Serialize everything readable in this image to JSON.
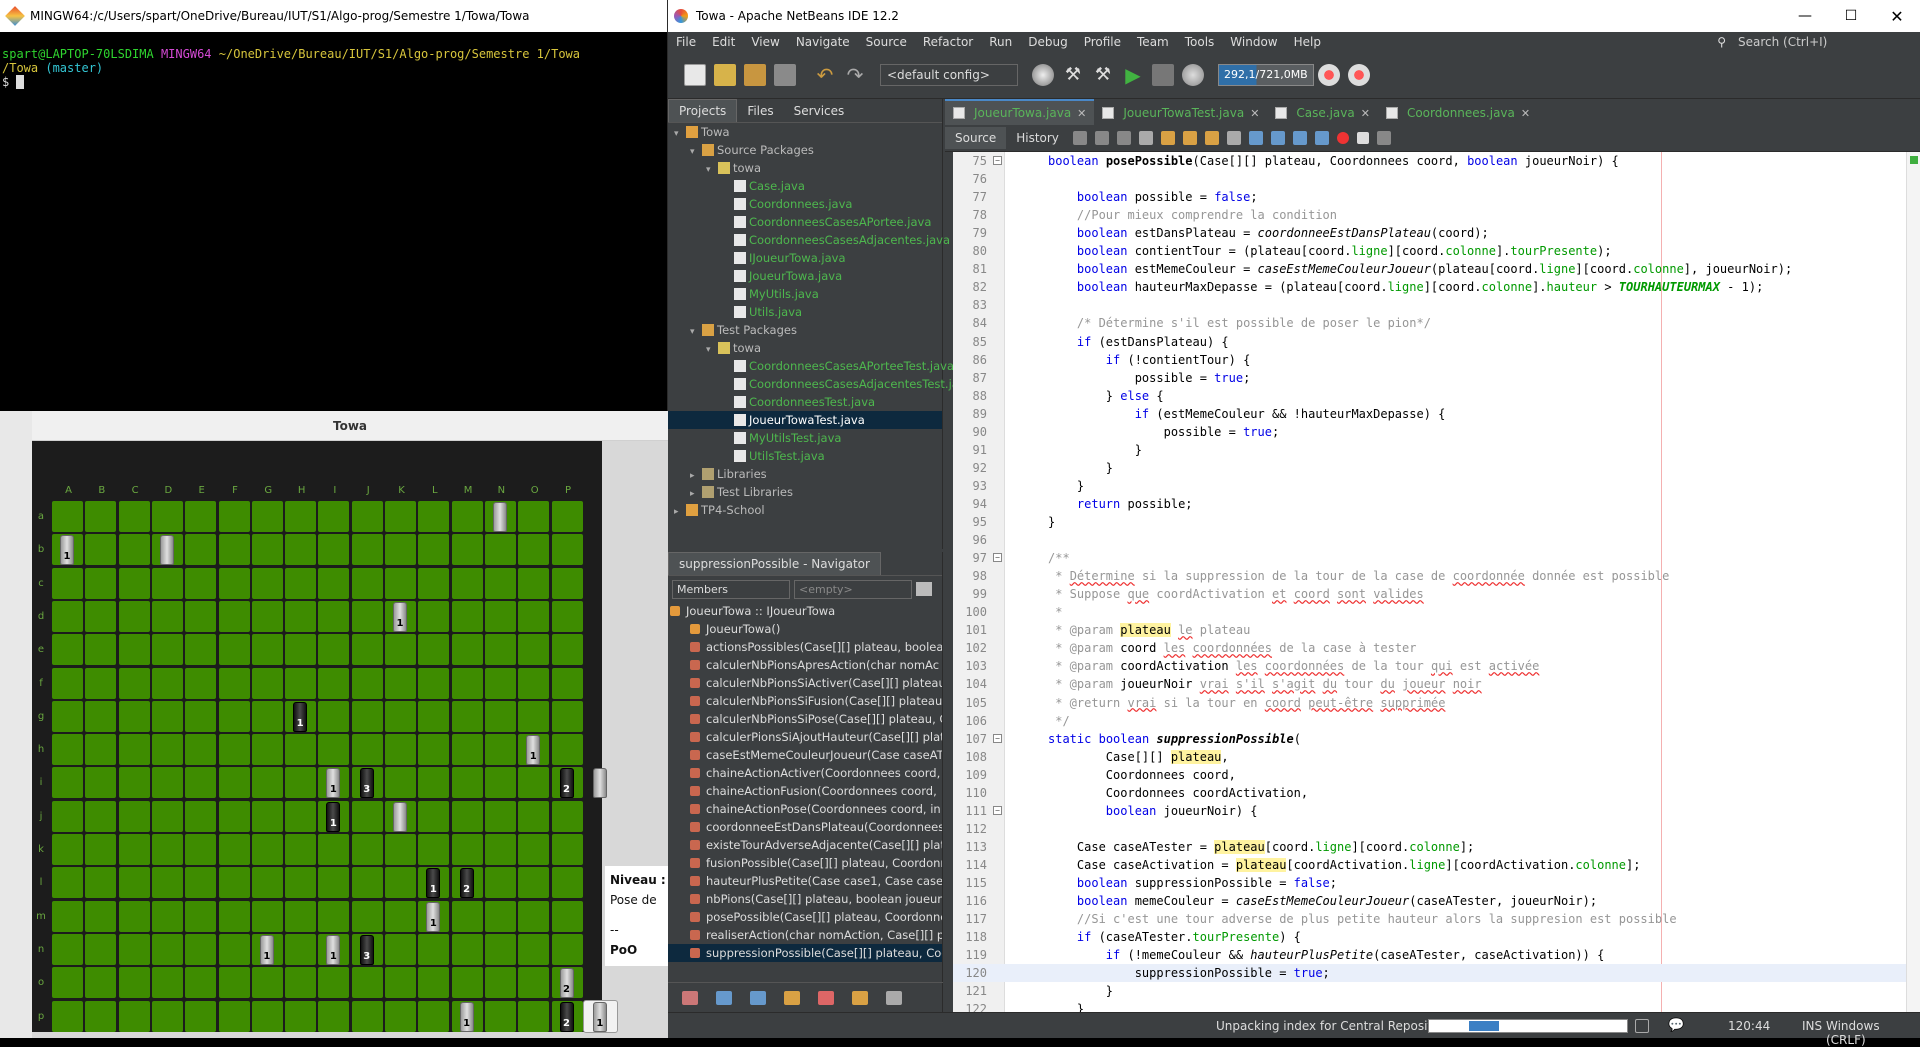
{
  "terminal": {
    "title": "MINGW64:/c/Users/spart/OneDrive/Bureau/IUT/S1/Algo-prog/Semestre 1/Towa/Towa",
    "prompt_user": "spart@LAPTOP-70LSDIMA",
    "prompt_env": "MINGW64",
    "prompt_path": "~/OneDrive/Bureau/IUT/S1/Algo-prog/Semestre 1/Towa",
    "prompt_path2": "/Towa",
    "prompt_branch": "(master)",
    "prompt_char": "$"
  },
  "game": {
    "title": "Towa",
    "columns": [
      "A",
      "B",
      "C",
      "D",
      "E",
      "F",
      "G",
      "H",
      "I",
      "J",
      "K",
      "L",
      "M",
      "N",
      "O",
      "P"
    ],
    "rows": [
      "a",
      "b",
      "c",
      "d",
      "e",
      "f",
      "g",
      "h",
      "i",
      "j",
      "k",
      "l",
      "m",
      "n",
      "o",
      "p"
    ],
    "pieces": [
      {
        "row": 0,
        "col": 13,
        "color": "w",
        "label": ""
      },
      {
        "row": 1,
        "col": 0,
        "color": "w",
        "label": "1"
      },
      {
        "row": 1,
        "col": 3,
        "color": "w",
        "label": ""
      },
      {
        "row": 3,
        "col": 10,
        "color": "w",
        "label": "1"
      },
      {
        "row": 6,
        "col": 7,
        "color": "b",
        "label": "1"
      },
      {
        "row": 7,
        "col": 14,
        "color": "w",
        "label": "1"
      },
      {
        "row": 8,
        "col": 8,
        "color": "w",
        "label": "1"
      },
      {
        "row": 8,
        "col": 9,
        "color": "b",
        "label": "3"
      },
      {
        "row": 8,
        "col": 15,
        "color": "b",
        "label": "2"
      },
      {
        "row": 8,
        "col": 16,
        "color": "w",
        "label": ""
      },
      {
        "row": 9,
        "col": 8,
        "color": "b",
        "label": "1"
      },
      {
        "row": 9,
        "col": 10,
        "color": "w",
        "label": ""
      },
      {
        "row": 11,
        "col": 11,
        "color": "b",
        "label": "1"
      },
      {
        "row": 11,
        "col": 12,
        "color": "b",
        "label": "2"
      },
      {
        "row": 12,
        "col": 11,
        "color": "w",
        "label": "1"
      },
      {
        "row": 13,
        "col": 6,
        "color": "w",
        "label": "1"
      },
      {
        "row": 13,
        "col": 8,
        "color": "w",
        "label": "1"
      },
      {
        "row": 13,
        "col": 9,
        "color": "b",
        "label": "3"
      },
      {
        "row": 14,
        "col": 15,
        "color": "w",
        "label": "2"
      },
      {
        "row": 15,
        "col": 12,
        "color": "w",
        "label": "1"
      },
      {
        "row": 15,
        "col": 15,
        "color": "b",
        "label": "2"
      },
      {
        "row": 15,
        "col": 16,
        "color": "w",
        "label": "1"
      }
    ],
    "info": {
      "line1": "Niveau :",
      "line2": "Pose de",
      "line3": "--",
      "line4": "PoO"
    }
  },
  "netbeans": {
    "title": "Towa - Apache NetBeans IDE 12.2",
    "menu": [
      "File",
      "Edit",
      "View",
      "Navigate",
      "Source",
      "Refactor",
      "Run",
      "Debug",
      "Profile",
      "Team",
      "Tools",
      "Window",
      "Help"
    ],
    "search_placeholder": "Search (Ctrl+I)",
    "config": "<default config>",
    "memory": "292,1/721,0MB",
    "panel_tabs": [
      "Projects",
      "Files",
      "Services"
    ],
    "tree": [
      {
        "depth": 0,
        "label": "Towa",
        "kind": "project"
      },
      {
        "depth": 1,
        "label": "Source Packages",
        "kind": "pkgroot"
      },
      {
        "depth": 2,
        "label": "towa",
        "kind": "pkg"
      },
      {
        "depth": 3,
        "label": "Case.java",
        "kind": "java"
      },
      {
        "depth": 3,
        "label": "Coordonnees.java",
        "kind": "java"
      },
      {
        "depth": 3,
        "label": "CoordonneesCasesAPortee.java",
        "kind": "java"
      },
      {
        "depth": 3,
        "label": "CoordonneesCasesAdjacentes.java",
        "kind": "java"
      },
      {
        "depth": 3,
        "label": "IJoueurTowa.java",
        "kind": "java"
      },
      {
        "depth": 3,
        "label": "JoueurTowa.java",
        "kind": "java"
      },
      {
        "depth": 3,
        "label": "MyUtils.java",
        "kind": "java"
      },
      {
        "depth": 3,
        "label": "Utils.java",
        "kind": "java"
      },
      {
        "depth": 1,
        "label": "Test Packages",
        "kind": "pkgroot"
      },
      {
        "depth": 2,
        "label": "towa",
        "kind": "pkg"
      },
      {
        "depth": 3,
        "label": "CoordonneesCasesAPorteeTest.java",
        "kind": "java"
      },
      {
        "depth": 3,
        "label": "CoordonneesCasesAdjacentesTest.java",
        "kind": "java"
      },
      {
        "depth": 3,
        "label": "CoordonneesTest.java",
        "kind": "java"
      },
      {
        "depth": 3,
        "label": "JoueurTowaTest.java",
        "kind": "java-sel"
      },
      {
        "depth": 3,
        "label": "MyUtilsTest.java",
        "kind": "java"
      },
      {
        "depth": 3,
        "label": "UtilsTest.java",
        "kind": "java"
      },
      {
        "depth": 1,
        "label": "Libraries",
        "kind": "lib"
      },
      {
        "depth": 1,
        "label": "Test Libraries",
        "kind": "lib"
      },
      {
        "depth": 0,
        "label": "TP4-School",
        "kind": "project"
      }
    ],
    "navigator": {
      "title": "suppressionPossible - Navigator",
      "filter": "Members",
      "filter2": "<empty>",
      "class": "JoueurTowa :: IJoueurTowa",
      "members": [
        "JoueurTowa()",
        "actionsPossibles(Case[][] plateau, boolean",
        "calculerNbPionsApresAction(char nomAc",
        "calculerNbPionsSiActiver(Case[][] plateau",
        "calculerNbPionsSiFusion(Case[][] plateau,",
        "calculerNbPionsSiPose(Case[][] plateau, C",
        "calculerPionsSiAjoutHauteur(Case[][] plat",
        "caseEstMemeCouleurJoueur(Case caseAT",
        "chaineActionActiver(Coordonnees coord,",
        "chaineActionFusion(Coordonnees coord,",
        "chaineActionPose(Coordonnees coord, in",
        "coordonneeEstDansPlateau(Coordonnees",
        "existeTourAdverseAdjacente(Case[][] plat",
        "fusionPossible(Case[][] plateau, Coordonn",
        "hauteurPlusPetite(Case case1, Case case2)",
        "nbPions(Case[][] plateau, boolean joueurl",
        "posePossible(Case[][] plateau, Coordonne",
        "realiserAction(char nomAction, Case[][] p",
        "suppressionPossible(Case[][] plateau, Coc"
      ]
    },
    "editor_tabs": [
      "JoueurTowa.java",
      "JoueurTowaTest.java",
      "Case.java",
      "Coordonnees.java"
    ],
    "source_tabs": [
      "Source",
      "History"
    ],
    "status": {
      "task": "Unpacking index for Central Repository",
      "pos": "120:44",
      "ins": "INS",
      "eol": "Windows (CRLF)"
    }
  }
}
